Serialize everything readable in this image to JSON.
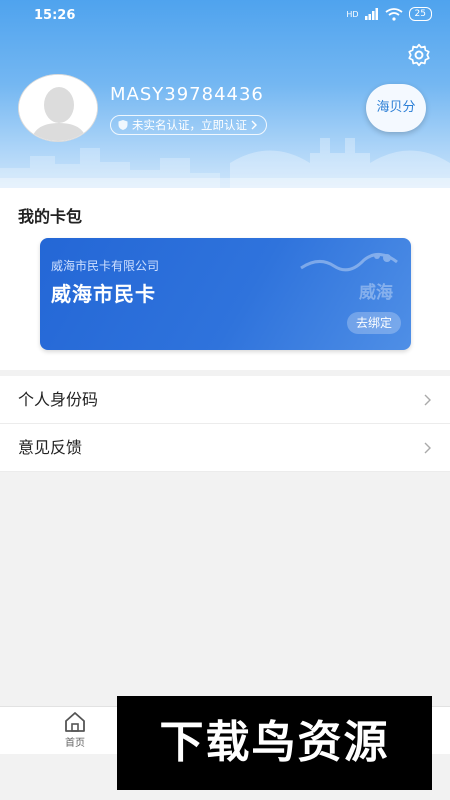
{
  "status_bar": {
    "time": "15:26",
    "network": "HD",
    "battery": "25"
  },
  "header": {
    "username": "MASY39784436",
    "verify_text": "未实名认证，立即认证",
    "score_button": "海贝分"
  },
  "wallet": {
    "title": "我的卡包",
    "card": {
      "company": "威海市民卡有限公司",
      "name": "威海市民卡",
      "logo_text": "威海",
      "action": "去绑定"
    }
  },
  "menu": [
    {
      "label": "个人身份码"
    },
    {
      "label": "意见反馈"
    }
  ],
  "tabbar": {
    "home_label": "首页"
  },
  "watermark": "下载鸟资源",
  "colors": {
    "header_blue": "#4fa3ee",
    "card_blue": "#2467d6",
    "accent": "#2c7fd6"
  }
}
